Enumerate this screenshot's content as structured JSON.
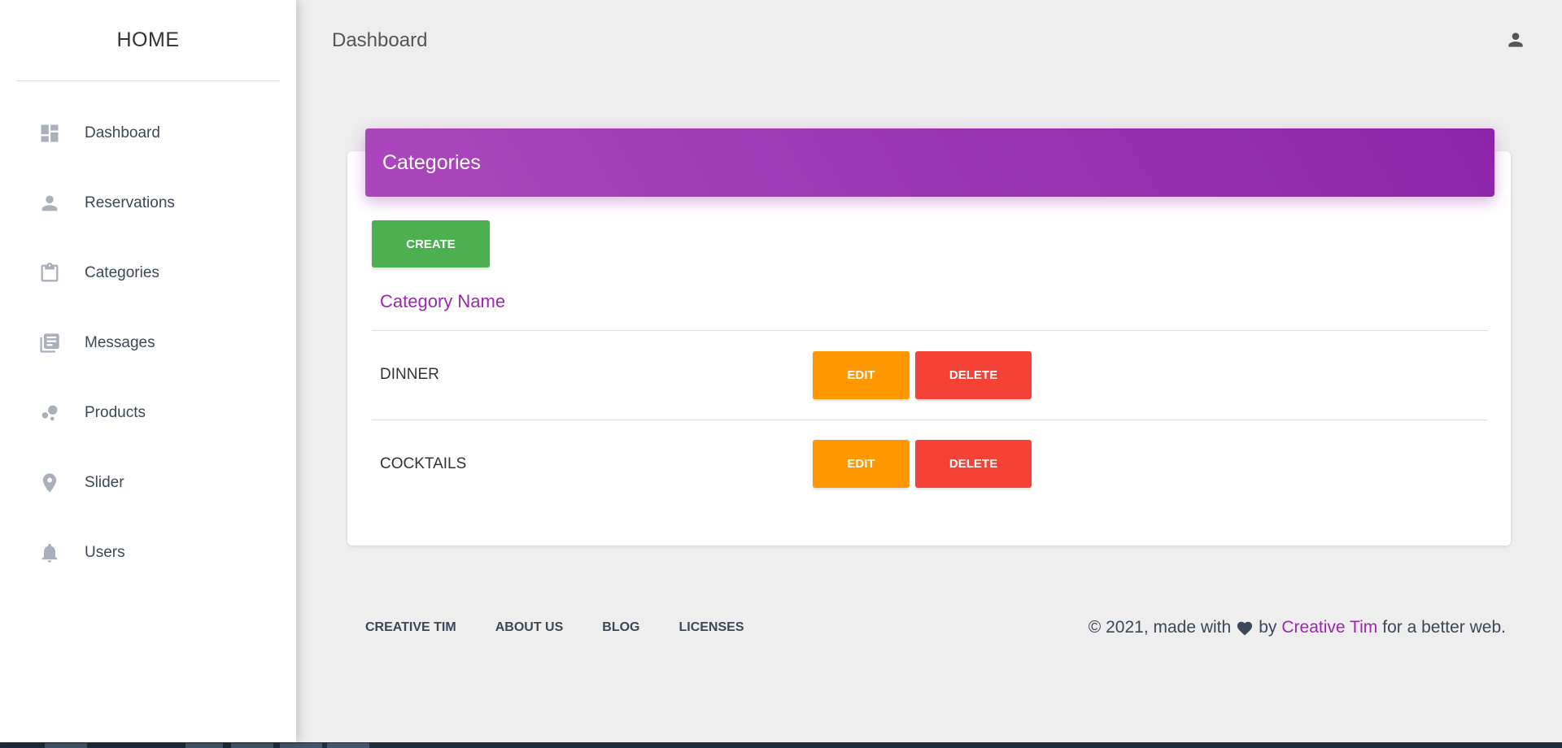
{
  "sidebar": {
    "brand": "HOME",
    "items": [
      {
        "label": "Dashboard",
        "icon": "dashboard-icon"
      },
      {
        "label": "Reservations",
        "icon": "person-icon"
      },
      {
        "label": "Categories",
        "icon": "clipboard-icon"
      },
      {
        "label": "Messages",
        "icon": "library-books-icon"
      },
      {
        "label": "Products",
        "icon": "bubble-chart-icon"
      },
      {
        "label": "Slider",
        "icon": "location-pin-icon"
      },
      {
        "label": "Users",
        "icon": "bell-icon"
      }
    ]
  },
  "header": {
    "title": "Dashboard",
    "user_icon": "user-icon"
  },
  "card": {
    "title": "Categories",
    "create_label": "CREATE",
    "column_header": "Category Name",
    "rows": [
      {
        "name": "DINNER",
        "edit_label": "EDIT",
        "delete_label": "DELETE"
      },
      {
        "name": "COCKTAILS",
        "edit_label": "EDIT",
        "delete_label": "DELETE"
      }
    ]
  },
  "footer": {
    "links": [
      "CREATIVE TIM",
      "ABOUT US",
      "BLOG",
      "LICENSES"
    ],
    "copyright_prefix": "© 2021, made with",
    "copyright_by": "by",
    "copyright_brand": "Creative Tim",
    "copyright_suffix": "for a better web."
  },
  "colors": {
    "accent": "#9c27b0",
    "create": "#4caf50",
    "edit": "#ff9800",
    "delete": "#f44336"
  }
}
